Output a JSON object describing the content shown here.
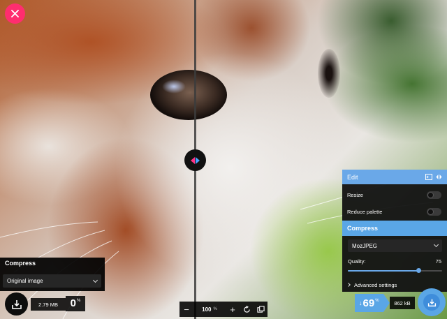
{
  "app": {
    "close_icon": "close-icon"
  },
  "left_panel": {
    "title": "Compress",
    "method_selected": "Original image",
    "result_size": "2.79 MB",
    "savings_percent": "0",
    "savings_unit": "%"
  },
  "zoom": {
    "minus": "−",
    "value": "100",
    "unit": "%",
    "plus": "+"
  },
  "edit_panel": {
    "title": "Edit",
    "resize_label": "Resize",
    "resize_enabled": false,
    "reduce_palette_label": "Reduce palette",
    "reduce_palette_enabled": false
  },
  "compress_panel": {
    "title": "Compress",
    "method_selected": "MozJPEG",
    "quality_label": "Quality:",
    "quality_value": "75",
    "quality_fraction": 0.75,
    "advanced_label": "Advanced settings"
  },
  "right_results": {
    "arrow": "↓",
    "savings_percent": "69",
    "savings_unit": "%",
    "result_size": "862 kB"
  },
  "colors": {
    "accent_pink": "#ff2d6f",
    "accent_blue": "#5aa6e6",
    "panel_dark": "#121212"
  }
}
